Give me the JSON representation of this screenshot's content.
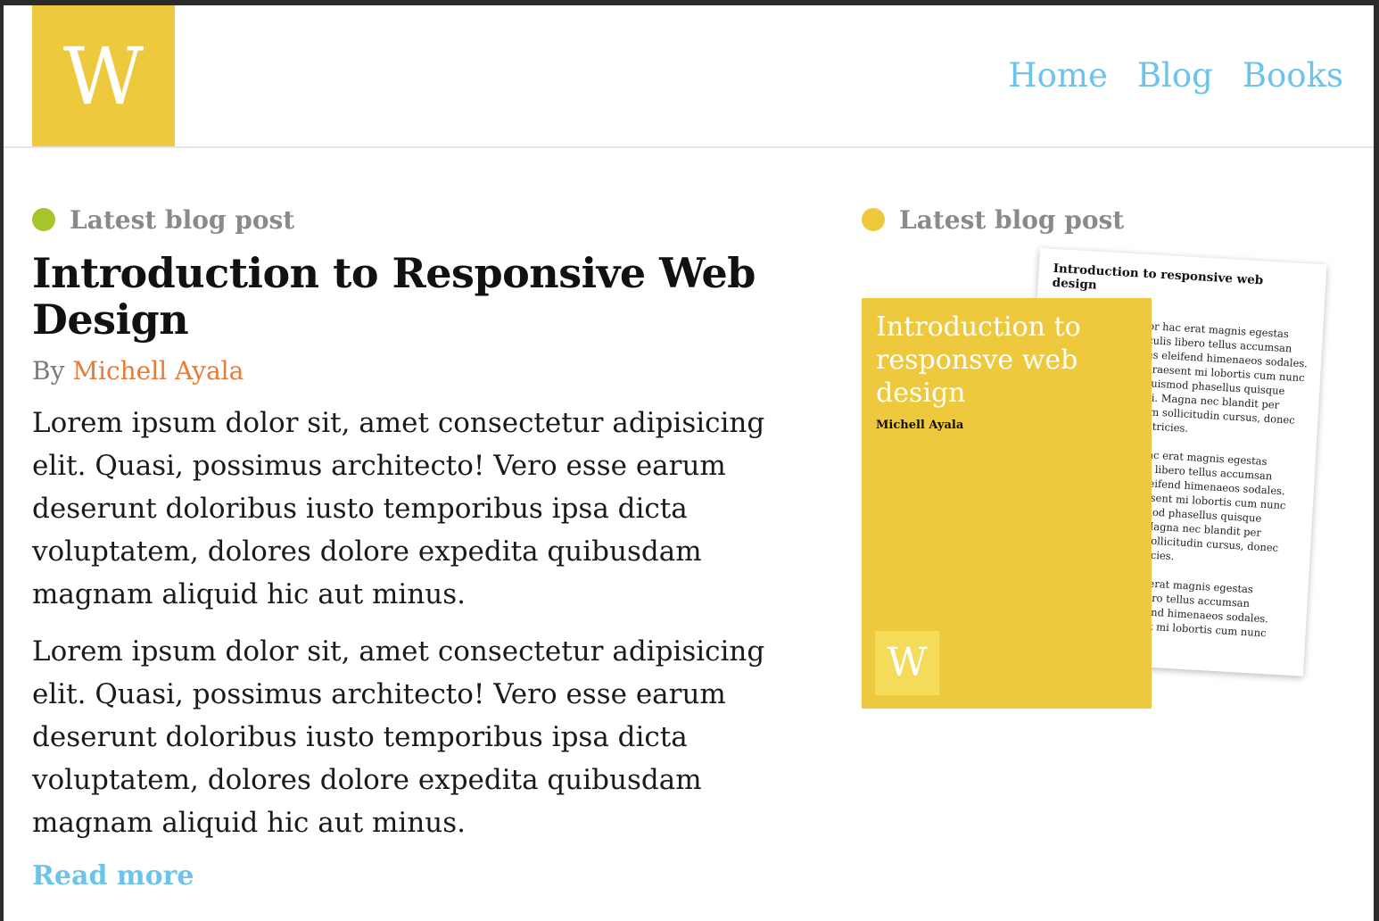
{
  "header": {
    "logo_letter": "W",
    "nav": [
      "Home",
      "Blog",
      "Books"
    ]
  },
  "colors": {
    "brand_yellow": "#efc93d",
    "link_blue": "#6cc4ea",
    "author_orange": "#e87a36",
    "green_dot": "#a4c52c",
    "yellow_dot": "#efc93d"
  },
  "article": {
    "eyebrow": "Latest blog post",
    "title": "Introduction to Responsive Web Design",
    "by_label": "By",
    "author": "Michell Ayala",
    "paragraphs": [
      "Lorem ipsum dolor sit, amet consectetur adipisicing elit. Quasi, possimus architecto! Vero esse earum deserunt doloribus iusto temporibus ipsa dicta voluptatem, dolores dolore expedita quibusdam magnam aliquid hic aut minus.",
      "Lorem ipsum dolor sit, amet consectetur adipisicing elit. Quasi, possimus architecto! Vero esse earum deserunt doloribus iusto temporibus ipsa dicta voluptatem, dolores dolore expedita quibusdam magnam aliquid hic aut minus."
    ],
    "read_more": "Read more"
  },
  "aside": {
    "eyebrow": "Latest blog post",
    "book": {
      "cover_title": "Introduction to responsve web design",
      "cover_author": "Michell Ayala",
      "cover_logo_letter": "W",
      "back_title": "Introduction to responsive web design",
      "back_lines": [
        "or hac erat magnis egestas",
        "culis libero tellus accumsan",
        "us eleifend himenaeos sodales.",
        "praesent mi lobortis cum nunc",
        "euismod phasellus quisque",
        "iti. Magna nec blandit per",
        "am sollicitudin cursus, donec",
        "ultricies.",
        "",
        "hac erat magnis egestas",
        "lis libero tellus accumsan",
        "eleifend himenaeos sodales.",
        "aesent mi lobortis cum nunc",
        "smod phasellus quisque",
        ". Magna nec blandit per",
        "n sollicitudin cursus, donec",
        "ltricies.",
        "",
        "ac erat magnis egestas",
        "libero tellus accumsan",
        "eifend himenaeos sodales.",
        "sent mi lobortis cum nunc"
      ]
    }
  }
}
